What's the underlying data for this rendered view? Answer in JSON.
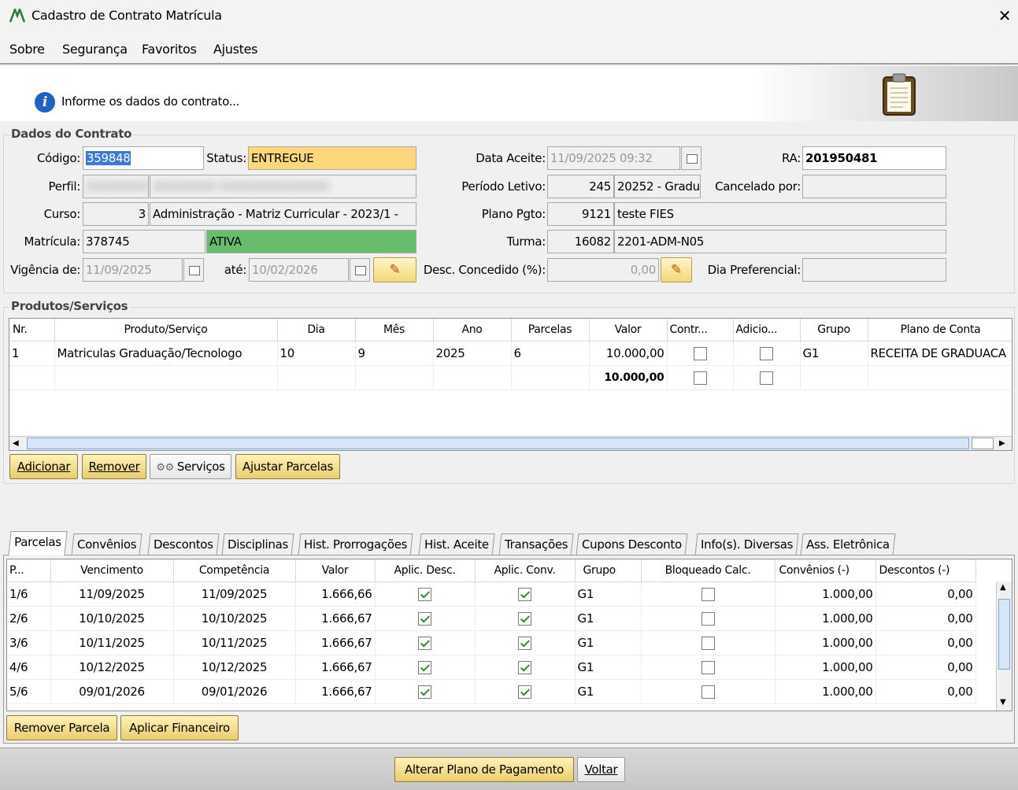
{
  "window": {
    "title": "Cadastro de Contrato Matrícula",
    "close": "✕"
  },
  "menu": [
    {
      "label": "Sobre"
    },
    {
      "label": "Segurança"
    },
    {
      "label": "Favoritos"
    },
    {
      "label": "Ajustes"
    }
  ],
  "banner": {
    "info": "Informe os dados do contrato..."
  },
  "contract": {
    "legend": "Dados do Contrato",
    "codigo_label": "Código:",
    "codigo": "359848",
    "status_label": "Status:",
    "status": "ENTREGUE",
    "data_aceite_label": "Data Aceite:",
    "data_aceite": "11/09/2025 09:32",
    "ra_label": "RA:",
    "ra": "201950481",
    "perfil_label": "Perfil:",
    "perfil_hidden": "XXXXXXXX XXXXXXXXXXXXXX",
    "periodo_label": "Período Letivo:",
    "periodo_code": "245",
    "periodo_desc": "20252 - Gradu",
    "cancelado_label": "Cancelado por:",
    "cancelado": "",
    "curso_label": "Curso:",
    "curso_code": "3",
    "curso_desc": "Administração - Matriz Curricular - 2023/1 -",
    "plano_label": "Plano Pgto:",
    "plano_code": "9121",
    "plano_desc": "teste FIES",
    "matricula_label": "Matrícula:",
    "matricula": "378745",
    "matricula_status": "ATIVA",
    "turma_label": "Turma:",
    "turma_code": "16082",
    "turma_desc": "2201-ADM-N05",
    "vigencia_label": "Vigência de:",
    "vigencia_de": "11/09/2025",
    "ate_label": "até:",
    "vigencia_ate": "10/02/2026",
    "desc_label": "Desc. Concedido (%):",
    "desc": "0,00",
    "dia_pref_label": "Dia Preferencial:",
    "dia_pref": ""
  },
  "products": {
    "legend": "Produtos/Serviços",
    "columns": [
      "Nr.",
      "Produto/Serviço",
      "Dia",
      "Mês",
      "Ano",
      "Parcelas",
      "Valor",
      "Contr...",
      "Adicio...",
      "Grupo",
      "Plano de Conta"
    ],
    "rows": [
      {
        "nr": "1",
        "produto": "Matriculas Graduação/Tecnologo",
        "dia": "10",
        "mes": "9",
        "ano": "2025",
        "parcelas": "6",
        "valor": "10.000,00",
        "grupo": "G1",
        "plano": "RECEITA DE GRADUACA"
      }
    ],
    "total": "10.000,00",
    "buttons": {
      "adicionar": "Adicionar",
      "remover": "Remover",
      "servicos": "Serviços",
      "ajustar": "Ajustar Parcelas"
    }
  },
  "tabs": [
    "Parcelas",
    "Convênios",
    "Descontos",
    "Disciplinas",
    "Hist. Prorrogações",
    "Hist. Aceite",
    "Transações",
    "Cupons Desconto",
    "Info(s). Diversas",
    "Ass. Eletrônica"
  ],
  "parcelas": {
    "columns": [
      "P...",
      "Vencimento",
      "Competência",
      "Valor",
      "Aplic. Desc.",
      "Aplic. Conv.",
      "Grupo",
      "Bloqueado Calc.",
      "Convênios (-)",
      "Descontos (-)"
    ],
    "rows": [
      {
        "p": "1/6",
        "venc": "11/09/2025",
        "comp": "11/09/2025",
        "valor": "1.666,66",
        "grupo": "G1",
        "conv": "1.000,00",
        "desc": "0,00"
      },
      {
        "p": "2/6",
        "venc": "10/10/2025",
        "comp": "10/10/2025",
        "valor": "1.666,67",
        "grupo": "G1",
        "conv": "1.000,00",
        "desc": "0,00"
      },
      {
        "p": "3/6",
        "venc": "10/11/2025",
        "comp": "10/11/2025",
        "valor": "1.666,67",
        "grupo": "G1",
        "conv": "1.000,00",
        "desc": "0,00"
      },
      {
        "p": "4/6",
        "venc": "10/12/2025",
        "comp": "10/12/2025",
        "valor": "1.666,67",
        "grupo": "G1",
        "conv": "1.000,00",
        "desc": "0,00"
      },
      {
        "p": "5/6",
        "venc": "09/01/2026",
        "comp": "09/01/2026",
        "valor": "1.666,67",
        "grupo": "G1",
        "conv": "1.000,00",
        "desc": "0,00"
      }
    ],
    "buttons": {
      "remover": "Remover Parcela",
      "aplicar": "Aplicar Financeiro"
    }
  },
  "footer": {
    "alterar": "Alterar Plano de Pagamento",
    "voltar": "Voltar"
  },
  "colors": {
    "status_bg": "#fdd77b",
    "ativa_bg": "#67bd6c",
    "button_gold": "#f1d77b",
    "selection": "#3b78d8"
  }
}
